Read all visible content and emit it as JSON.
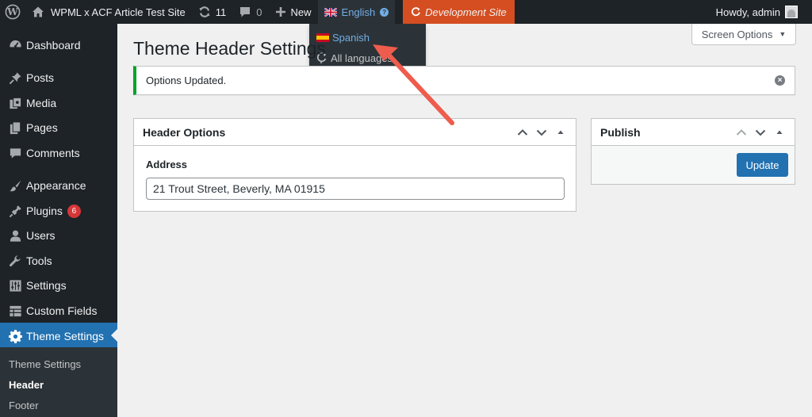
{
  "adminbar": {
    "site_name": "WPML x ACF Article Test Site",
    "updates_count": "11",
    "comments_count": "0",
    "new_label": "New",
    "language_label": "English",
    "dev_site_label": "Development Site",
    "howdy_label": "Howdy, admin"
  },
  "language_dropdown": {
    "options": [
      {
        "label": "Spanish",
        "icon": "spain-flag-icon"
      },
      {
        "label": "All languages",
        "icon": "language-icon"
      }
    ]
  },
  "sidebar": {
    "items": [
      {
        "label": "Dashboard",
        "icon": "dashboard-icon"
      },
      {
        "label": "Posts",
        "icon": "pin-icon"
      },
      {
        "label": "Media",
        "icon": "media-icon"
      },
      {
        "label": "Pages",
        "icon": "pages-icon"
      },
      {
        "label": "Comments",
        "icon": "comment-icon"
      },
      {
        "label": "Appearance",
        "icon": "brush-icon"
      },
      {
        "label": "Plugins",
        "icon": "plugin-icon",
        "badge": "6"
      },
      {
        "label": "Users",
        "icon": "user-icon"
      },
      {
        "label": "Tools",
        "icon": "wrench-icon"
      },
      {
        "label": "Settings",
        "icon": "sliders-icon"
      },
      {
        "label": "Custom Fields",
        "icon": "table-icon"
      },
      {
        "label": "Theme Settings",
        "icon": "gear-icon",
        "current": true
      }
    ],
    "submenu": [
      {
        "label": "Theme Settings"
      },
      {
        "label": "Header",
        "active": true
      },
      {
        "label": "Footer"
      }
    ]
  },
  "main": {
    "page_title": "Theme Header Settings",
    "screen_options_label": "Screen Options",
    "notice_text": "Options Updated.",
    "header_box": {
      "title": "Header Options",
      "field_label": "Address",
      "field_value": "21 Trout Street, Beverly, MA 01915"
    },
    "publish_box": {
      "title": "Publish",
      "update_label": "Update"
    }
  },
  "colors": {
    "adminbar_bg": "#1d2327",
    "accent_blue": "#2271b1",
    "dev_site_orange": "#d54e21",
    "notice_green": "#00a32a",
    "badge_red": "#d63638",
    "annotation_arrow": "#ee5c4d"
  }
}
